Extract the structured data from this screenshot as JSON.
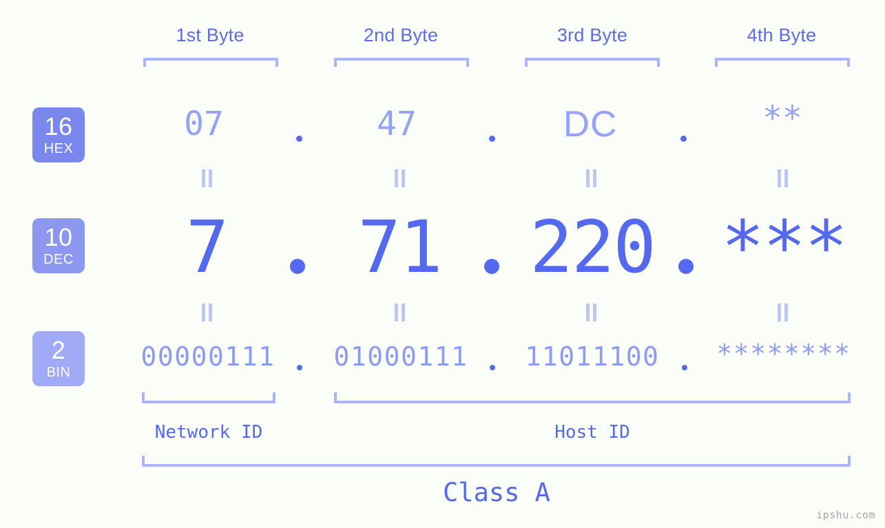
{
  "meta": {
    "background_color": "#fbfdf8",
    "accent_color": "#5469ed",
    "light_accent_color": "#aab4fa",
    "watermark": "ipshu.com"
  },
  "byte_headers": [
    {
      "label": "1st Byte"
    },
    {
      "label": "2nd Byte"
    },
    {
      "label": "3rd Byte"
    },
    {
      "label": "4th Byte"
    }
  ],
  "bases": [
    {
      "number": "16",
      "name": "HEX",
      "color": "#7a87ec"
    },
    {
      "number": "10",
      "name": "DEC",
      "color": "#8c98f0"
    },
    {
      "number": "2",
      "name": "BIN",
      "color": "#9fabf6"
    }
  ],
  "rows": {
    "hex": {
      "values": [
        "07",
        "47",
        "DC",
        "**"
      ],
      "separator": "."
    },
    "dec": {
      "values": [
        "7",
        "71",
        "220",
        "***"
      ],
      "separator": "."
    },
    "bin": {
      "values": [
        "00000111",
        "01000111",
        "11011100",
        "********"
      ],
      "separator": "."
    }
  },
  "sections": [
    {
      "label": "Network ID"
    },
    {
      "label": "Host ID"
    }
  ],
  "class": {
    "label": "Class A"
  }
}
